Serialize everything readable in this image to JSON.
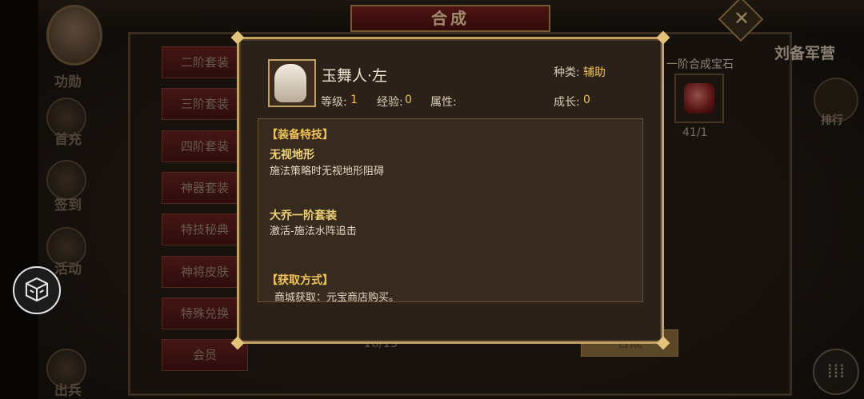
{
  "background": {
    "synth_title": "合成",
    "close_glyph": "✕",
    "left_icons": [
      {
        "label": "功勋"
      },
      {
        "label": "首充"
      },
      {
        "label": "签到"
      },
      {
        "label": "活动"
      },
      {
        "label": "出兵"
      }
    ],
    "menu": [
      "二阶套装",
      "三阶套装",
      "四阶套装",
      "神器套装",
      "特技秘典",
      "神将皮肤",
      "特殊兑换",
      "会员"
    ],
    "gem_label": "一阶合成宝石",
    "gem_count": "41/1",
    "camp_label": "刘备军营",
    "rank_label": "排行",
    "page_indicator": "16/15",
    "synth_button": "合成",
    "more_glyph": "⁞⁞⁞",
    "colors": {
      "accent_gold": "#f0c35a",
      "frame_gold": "#c3a064",
      "title_red": "#7a1f1f"
    }
  },
  "popup": {
    "item_name": "玉舞人·左",
    "type_label": "种类:",
    "type_value": "辅助",
    "level_label": "等级:",
    "level_value": "1",
    "exp_label": "经验:",
    "exp_value": "0",
    "attr_label": "属性:",
    "growth_label": "成长:",
    "growth_value": "0",
    "special_header": "【装备特技】",
    "skills": [
      {
        "name": "无视地形",
        "desc": "施法策略时无视地形阻碍"
      },
      {
        "name": "大乔一阶套装",
        "desc": "激活-施法水阵追击"
      }
    ],
    "source_header": "【获取方式】",
    "source_text": "商城获取：元宝商店购买。"
  },
  "icons": [
    "close-icon",
    "avatar",
    "gem-icon",
    "rank-icon",
    "cube-icon",
    "more-icon",
    "item-icon"
  ]
}
